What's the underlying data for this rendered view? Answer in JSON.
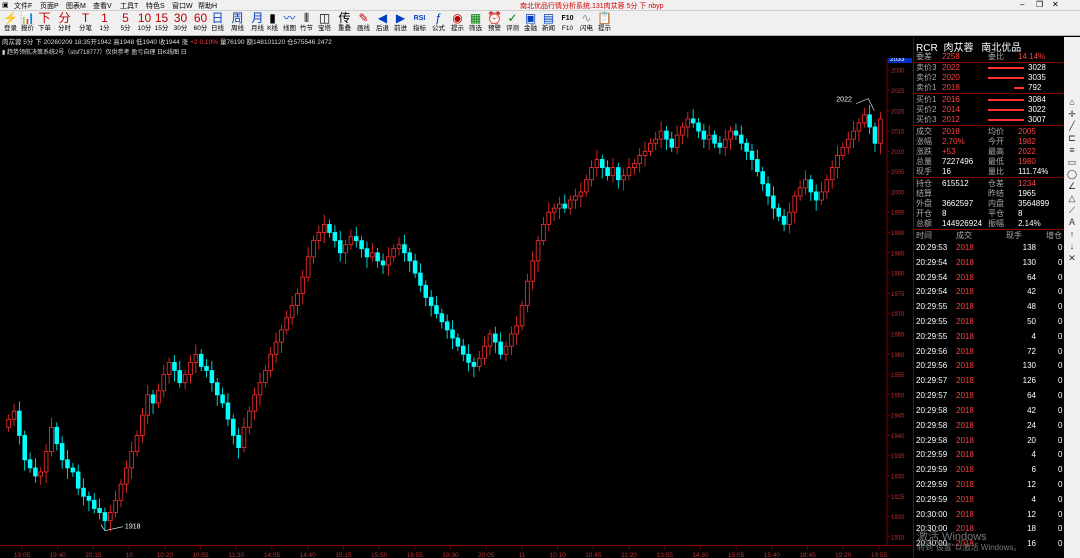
{
  "menubar": {
    "items": [
      "文件F",
      "页面P",
      "图表M",
      "查看V",
      "工具T",
      "特色S",
      "窗口W",
      "帮助H"
    ],
    "title": "南北优品行情分析系统.131肉苁蓉 5分 下 nbyp"
  },
  "toolbar": [
    {
      "g": "⚡",
      "l": "登录",
      "c": "#c08000",
      "icon": "login-icon"
    },
    {
      "g": "📊",
      "l": "报价",
      "c": "#c00000",
      "icon": "quote-icon"
    },
    {
      "g": "下",
      "l": "下单",
      "c": "#c00000",
      "icon": "order-icon"
    },
    {
      "g": "分",
      "l": "分时",
      "c": "#c00000",
      "icon": "timeshare-icon"
    },
    {
      "g": "T",
      "l": "分笔",
      "c": "#c00000",
      "icon": "tick-icon"
    },
    {
      "g": "1",
      "l": "1分",
      "c": "#c00000",
      "icon": "1min-icon"
    },
    {
      "g": "5",
      "l": "5分",
      "c": "#c00000",
      "icon": "5min-icon"
    },
    {
      "g": "10",
      "l": "10分",
      "c": "#c00000",
      "icon": "10min-icon"
    },
    {
      "g": "15",
      "l": "15分",
      "c": "#c00000",
      "icon": "15min-icon"
    },
    {
      "g": "30",
      "l": "30分",
      "c": "#c00000",
      "icon": "30min-icon"
    },
    {
      "g": "60",
      "l": "60分",
      "c": "#c00000",
      "icon": "60min-icon"
    },
    {
      "g": "日",
      "l": "日线",
      "c": "#0040c0",
      "icon": "daily-icon"
    },
    {
      "g": "周",
      "l": "周线",
      "c": "#0040c0",
      "icon": "weekly-icon"
    },
    {
      "g": "月",
      "l": "月线",
      "c": "#0040c0",
      "icon": "monthly-icon"
    },
    {
      "g": "▮",
      "l": "K线",
      "c": "#000",
      "icon": "kline-icon"
    },
    {
      "g": "〰",
      "l": "线图",
      "c": "#0040c0",
      "icon": "line-chart-icon"
    },
    {
      "g": "⦀",
      "l": "竹节",
      "c": "#000",
      "icon": "bamboo-icon"
    },
    {
      "g": "◫",
      "l": "宝塔",
      "c": "#000",
      "icon": "tower-icon"
    },
    {
      "g": "传",
      "l": "重叠",
      "c": "#000",
      "icon": "overlay-icon"
    },
    {
      "g": "✎",
      "l": "画线",
      "c": "#c00000",
      "icon": "draw-icon"
    },
    {
      "g": "◀",
      "l": "后退",
      "c": "#0040c0",
      "icon": "back-icon"
    },
    {
      "g": "▶",
      "l": "前进",
      "c": "#0040c0",
      "icon": "forward-icon"
    },
    {
      "g": "RSI",
      "l": "指标",
      "c": "#0040c0",
      "icon": "indicator-icon"
    },
    {
      "g": "ƒ",
      "l": "公式",
      "c": "#0040c0",
      "icon": "formula-icon"
    },
    {
      "g": "◉",
      "l": "提示",
      "c": "#c00000",
      "icon": "tips-icon"
    },
    {
      "g": "▦",
      "l": "筛选",
      "c": "#008000",
      "icon": "filter-icon"
    },
    {
      "g": "⏰",
      "l": "预警",
      "c": "#0040c0",
      "icon": "alert-icon"
    },
    {
      "g": "✓",
      "l": "评测",
      "c": "#008000",
      "icon": "evaluate-icon"
    },
    {
      "g": "▣",
      "l": "金融",
      "c": "#0040c0",
      "icon": "finance-icon"
    },
    {
      "g": "▤",
      "l": "新闻",
      "c": "#0040c0",
      "icon": "news-icon"
    },
    {
      "g": "F10",
      "l": "F10",
      "c": "#000",
      "icon": "f10-icon"
    },
    {
      "g": "∿",
      "l": "闪电",
      "c": "#999",
      "icon": "flash-icon"
    },
    {
      "g": "📋",
      "l": "提示",
      "c": "#c00000",
      "icon": "notes-icon"
    }
  ],
  "infobar": [
    {
      "t": "肉苁蓉 5分 下 20260209 18:35开1942 高1948 低1940 收1944 涨",
      "c": "#ddd"
    },
    {
      "t": "+2",
      "c": "#ff4040"
    },
    {
      "t": "0.10%",
      "c": "#ff4040"
    },
    {
      "t": "量76190",
      "c": "#ddd"
    },
    {
      "t": "额148101120",
      "c": "#ddd"
    },
    {
      "t": "仓575546",
      "c": "#ddd"
    },
    {
      "t": "2472",
      "c": "#ddd"
    }
  ],
  "studyline": "▮ 趋势领航决策系统2号（stsf718777）仅供参考 盈亏自理 日K线图 日",
  "price_axis": {
    "labels": [
      "2030",
      "2025",
      "2020",
      "2015",
      "2010",
      "2005",
      "2000",
      "1995",
      "1990",
      "1985",
      "1980",
      "1975",
      "1970",
      "1965",
      "1960",
      "1955",
      "1950",
      "1945",
      "1940",
      "1935",
      "1930",
      "1925",
      "1920",
      "1915"
    ],
    "current": "2033"
  },
  "time_axis": [
    "19:05",
    "19:40",
    "20:15",
    "10",
    "10:20",
    "10:55",
    "11:30",
    "14:05",
    "14:40",
    "15:15",
    "15:50",
    "18:55",
    "19:30",
    "20:05",
    "11",
    "10:10",
    "10:45",
    "11:20",
    "13:55",
    "14:30",
    "15:05",
    "15:40",
    "18:45",
    "19:20",
    "19:55"
  ],
  "chart_annotations": {
    "low": "1918",
    "high": "2022"
  },
  "chart_data": {
    "type": "candlestick",
    "description_note": "",
    "ylim": [
      1913,
      2033
    ],
    "closes": [
      1944,
      1946,
      1940,
      1934,
      1932,
      1930,
      1931,
      1936,
      1942,
      1938,
      1934,
      1932,
      1931,
      1927,
      1925,
      1924,
      1922,
      1921,
      1919,
      1921,
      1924,
      1928,
      1932,
      1936,
      1940,
      1945,
      1950,
      1948,
      1951,
      1955,
      1958,
      1956,
      1953,
      1955,
      1958,
      1960,
      1957,
      1956,
      1953,
      1950,
      1948,
      1944,
      1940,
      1937,
      1942,
      1946,
      1950,
      1953,
      1956,
      1960,
      1963,
      1966,
      1969,
      1972,
      1975,
      1979,
      1984,
      1988,
      1990,
      1992,
      1990,
      1988,
      1985,
      1987,
      1989,
      1988,
      1986,
      1984,
      1985,
      1983,
      1982,
      1984,
      1986,
      1987,
      1985,
      1983,
      1980,
      1977,
      1974,
      1972,
      1970,
      1968,
      1966,
      1964,
      1962,
      1960,
      1958,
      1957,
      1959,
      1962,
      1965,
      1963,
      1960,
      1962,
      1965,
      1967,
      1972,
      1978,
      1983,
      1988,
      1992,
      1995,
      1996,
      1997,
      1996,
      1998,
      1999,
      2000,
      2003,
      2006,
      2008,
      2006,
      2004,
      2006,
      2003,
      2004,
      2006,
      2007,
      2009,
      2010,
      2012,
      2013,
      2015,
      2013,
      2011,
      2014,
      2016,
      2018,
      2017,
      2015,
      2013,
      2014,
      2012,
      2011,
      2013,
      2015,
      2014,
      2012,
      2010,
      2008,
      2005,
      2002,
      1999,
      1996,
      1994,
      1992,
      1995,
      1999,
      2001,
      2003,
      2000,
      1998,
      2000,
      2003,
      2006,
      2009,
      2011,
      2013,
      2015,
      2017,
      2019,
      2016,
      2012,
      2018
    ]
  },
  "right_panel": {
    "header": {
      "code": "RCR",
      "name": "肉苁蓉",
      "group": "南北优品"
    },
    "weibi": {
      "label1": "委差",
      "v1": "2258",
      "label2": "委比",
      "v2": "14.14%"
    },
    "asks": [
      {
        "label": "卖价3",
        "price": "2022",
        "vol": "3028",
        "bar": 0.9
      },
      {
        "label": "卖价2",
        "price": "2020",
        "vol": "3035",
        "bar": 0.9
      },
      {
        "label": "卖价1",
        "price": "2018",
        "vol": "792",
        "bar": 0.25
      }
    ],
    "bids": [
      {
        "label": "买价1",
        "price": "2016",
        "vol": "3084",
        "bar": 0.9
      },
      {
        "label": "买价2",
        "price": "2014",
        "vol": "3022",
        "bar": 0.9
      },
      {
        "label": "买价3",
        "price": "2012",
        "vol": "3007",
        "bar": 0.9
      }
    ],
    "stats1": [
      {
        "l1": "成交",
        "v1": "2018",
        "c1": "red",
        "l2": "均价",
        "v2": "2005",
        "c2": "red"
      },
      {
        "l1": "涨幅",
        "v1": "2.70%",
        "c1": "red",
        "l2": "今开",
        "v2": "1982",
        "c2": "red"
      },
      {
        "l1": "涨跌",
        "v1": "+53",
        "c1": "red",
        "l2": "最高",
        "v2": "2022",
        "c2": "red"
      },
      {
        "l1": "总量",
        "v1": "7227496",
        "c1": "white",
        "l2": "最低",
        "v2": "1980",
        "c2": "red"
      },
      {
        "l1": "现手",
        "v1": "16",
        "c1": "white",
        "l2": "量比",
        "v2": "111.74%",
        "c2": "white"
      }
    ],
    "stats2": [
      {
        "l1": "持仓",
        "v1": "615512",
        "c1": "white",
        "l2": "仓差",
        "v2": "1234",
        "c2": "red"
      },
      {
        "l1": "结算",
        "v1": "",
        "c1": "white",
        "l2": "昨结",
        "v2": "1965",
        "c2": "white"
      },
      {
        "l1": "外盘",
        "v1": "3662597",
        "c1": "white",
        "l2": "内盘",
        "v2": "3564899",
        "c2": "white"
      },
      {
        "l1": "开仓",
        "v1": "8",
        "c1": "white",
        "l2": "平仓",
        "v2": "8",
        "c2": "white"
      },
      {
        "l1": "总额",
        "v1": "144926924",
        "c1": "white",
        "l2": "振幅",
        "v2": "2.14%",
        "c2": "white"
      }
    ],
    "ticks_header": [
      "时间",
      "成交",
      "现手",
      "增仓"
    ],
    "ticks": [
      [
        "20:29:53",
        "2018",
        "138",
        "0"
      ],
      [
        "20:29:54",
        "2018",
        "130",
        "0"
      ],
      [
        "20:29:54",
        "2018",
        "64",
        "0"
      ],
      [
        "20:29:54",
        "2018",
        "42",
        "0"
      ],
      [
        "20:29:55",
        "2018",
        "48",
        "0"
      ],
      [
        "20:29:55",
        "2018",
        "50",
        "0"
      ],
      [
        "20:29:55",
        "2018",
        "4",
        "0"
      ],
      [
        "20:29:56",
        "2018",
        "72",
        "0"
      ],
      [
        "20:29:56",
        "2018",
        "130",
        "0"
      ],
      [
        "20:29:57",
        "2018",
        "126",
        "0"
      ],
      [
        "20:29:57",
        "2018",
        "64",
        "0"
      ],
      [
        "20:29:58",
        "2018",
        "42",
        "0"
      ],
      [
        "20:29:58",
        "2018",
        "24",
        "0"
      ],
      [
        "20:29:58",
        "2018",
        "20",
        "0"
      ],
      [
        "20:29:59",
        "2018",
        "4",
        "0"
      ],
      [
        "20:29:59",
        "2018",
        "6",
        "0"
      ],
      [
        "20:29:59",
        "2018",
        "12",
        "0"
      ],
      [
        "20:29:59",
        "2018",
        "4",
        "0"
      ],
      [
        "20:30:00",
        "2018",
        "12",
        "0"
      ],
      [
        "20:30:00",
        "2018",
        "18",
        "0"
      ],
      [
        "20:30:00",
        "2018",
        "16",
        "0"
      ]
    ]
  },
  "watermark": {
    "line1": "激活 Windows",
    "line2": "转到\"设置\"以激活 Windows。"
  },
  "colors": {
    "up": "#ff3030",
    "down": "#00ffff",
    "axis": "#800000",
    "bg": "#000000"
  }
}
